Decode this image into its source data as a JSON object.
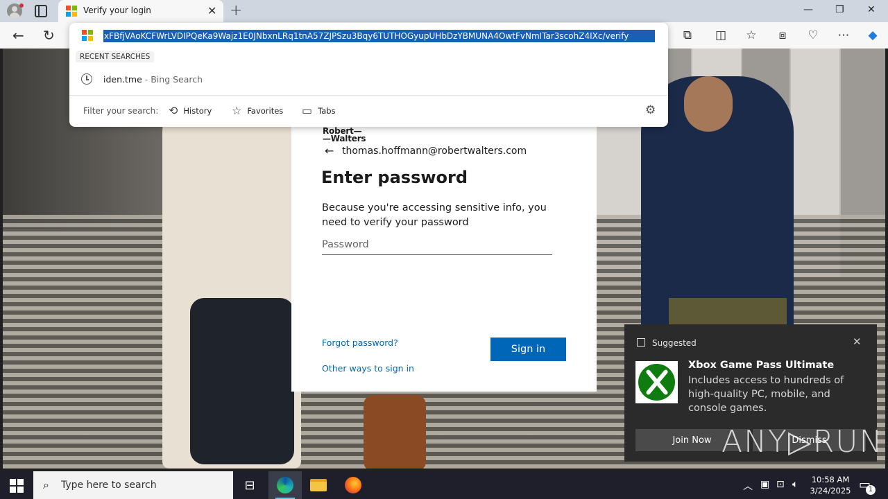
{
  "browser": {
    "tab_title": "Verify your login",
    "tab_close": "✕",
    "new_tab": "+",
    "window_controls": {
      "minimize": "—",
      "restore": "❐",
      "close": "✕"
    }
  },
  "omnibox": {
    "url": "xFBfjVAoKCFWrLVDIPQeKa9Wajz1E0JNbxnLRq1tnA57ZJPSzu3Bqy6TUTHOGyupUHbDzYBMUNA4OwtFvNmITar3scohZ4IXc/verify",
    "recent_label": "RECENT SEARCHES",
    "recent_query": "iden.tme",
    "recent_source": " - Bing Search",
    "filter_label": "Filter your search:",
    "filters": {
      "history": "History",
      "favorites": "Favorites",
      "tabs": "Tabs"
    }
  },
  "login": {
    "logo_line1": "Robert—",
    "logo_line2": "—Walters",
    "identity": "thomas.hoffmann@robertwalters.com",
    "heading": "Enter password",
    "description": "Because you're accessing sensitive info, you need to verify your password",
    "password_placeholder": "Password",
    "forgot": "Forgot password?",
    "other_ways": "Other ways to sign in",
    "sign_in": "Sign in",
    "accent_color": "#0067b8"
  },
  "toast": {
    "header": "Suggested",
    "title": "Xbox Game Pass Ultimate",
    "body": "Includes access to hundreds of high-quality PC, mobile, and console games.",
    "join": "Join Now",
    "dismiss": "Dismiss"
  },
  "watermark": "ANY▷RUN",
  "taskbar": {
    "search_placeholder": "Type here to search",
    "time": "10:58 AM",
    "date": "3/24/2025",
    "notification_count": "1"
  }
}
